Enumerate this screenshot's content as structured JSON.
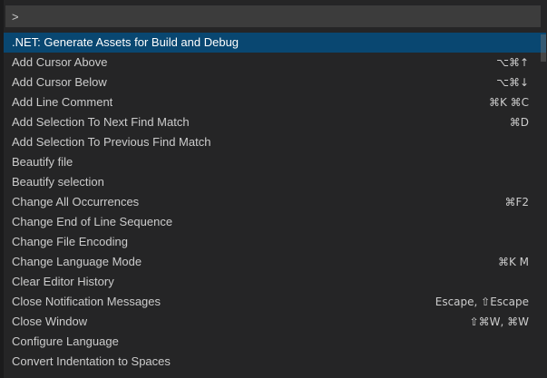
{
  "search": {
    "value": ">"
  },
  "commands": [
    {
      "label": ".NET: Generate Assets for Build and Debug",
      "keybinding": "",
      "selected": true
    },
    {
      "label": "Add Cursor Above",
      "keybinding": "⌥⌘↑"
    },
    {
      "label": "Add Cursor Below",
      "keybinding": "⌥⌘↓"
    },
    {
      "label": "Add Line Comment",
      "keybinding": "⌘K ⌘C"
    },
    {
      "label": "Add Selection To Next Find Match",
      "keybinding": "⌘D"
    },
    {
      "label": "Add Selection To Previous Find Match",
      "keybinding": ""
    },
    {
      "label": "Beautify file",
      "keybinding": ""
    },
    {
      "label": "Beautify selection",
      "keybinding": ""
    },
    {
      "label": "Change All Occurrences",
      "keybinding": "⌘F2"
    },
    {
      "label": "Change End of Line Sequence",
      "keybinding": ""
    },
    {
      "label": "Change File Encoding",
      "keybinding": ""
    },
    {
      "label": "Change Language Mode",
      "keybinding": "⌘K M"
    },
    {
      "label": "Clear Editor History",
      "keybinding": ""
    },
    {
      "label": "Close Notification Messages",
      "keybinding": "Escape, ⇧Escape"
    },
    {
      "label": "Close Window",
      "keybinding": "⇧⌘W, ⌘W"
    },
    {
      "label": "Configure Language",
      "keybinding": ""
    },
    {
      "label": "Convert Indentation to Spaces",
      "keybinding": ""
    }
  ],
  "colors": {
    "selected_background": "#094771",
    "text": "#cccccc",
    "panel": "#252526",
    "input": "#3c3c3c"
  }
}
